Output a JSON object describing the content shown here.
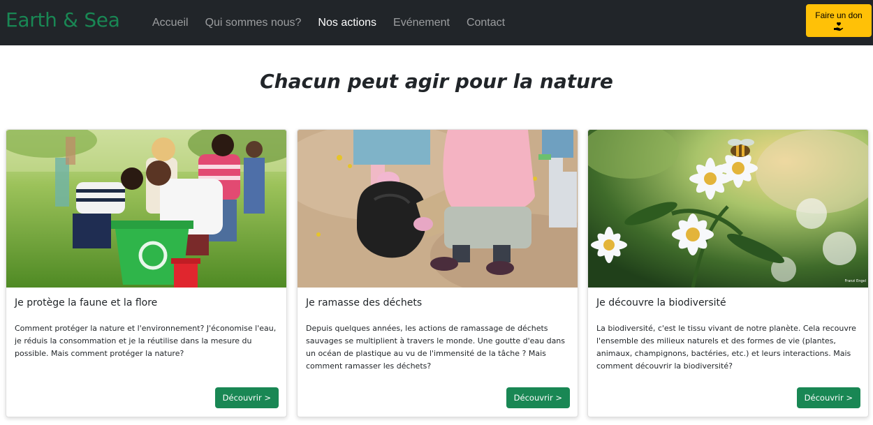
{
  "brand": {
    "name": "Earth & Sea",
    "color": "#198754"
  },
  "nav": {
    "items": [
      {
        "label": "Accueil",
        "active": false
      },
      {
        "label": "Qui sommes nous?",
        "active": false
      },
      {
        "label": "Nos actions",
        "active": true
      },
      {
        "label": "Evénement",
        "active": false
      },
      {
        "label": "Contact",
        "active": false
      }
    ]
  },
  "donate": {
    "label": "Faire un don",
    "icon": "hand-holding-heart-icon",
    "color": "#ffc107"
  },
  "main": {
    "heading": "Chacun peut agir pour la nature"
  },
  "cards": [
    {
      "image": "children-recycling-photo",
      "title": "Je protège la faune et la flore",
      "text": "Comment protéger la nature et l'environnement? J'économise l'eau, je réduis la consommation et je la réutilise dans la mesure du possible. Mais comment protéger la nature?",
      "button": "Découvrir >"
    },
    {
      "image": "children-picking-trash-photo",
      "title": "Je ramasse des déchets",
      "text": "Depuis quelques années, les actions de ramassage de déchets sauvages se multiplient à travers le monde. Une goutte d'eau dans un océan de plastique au vu de l'immensité de la tâche ? Mais comment ramasser les déchets?",
      "button": "Découvrir >"
    },
    {
      "image": "bee-on-flowers-photo",
      "title": "Je découvre la biodiversité",
      "text": "La biodiversité, c'est le tissu vivant de notre planète. Cela recouvre l'ensemble des milieux naturels et des formes de vie (plantes, animaux, champignons, bactéries, etc.) et leurs interactions. Mais comment découvrir la biodiversité?",
      "button": "Découvrir >",
      "credit": "Franzi Engel"
    }
  ],
  "colors": {
    "navbar": "#212529",
    "button": "#198754"
  }
}
